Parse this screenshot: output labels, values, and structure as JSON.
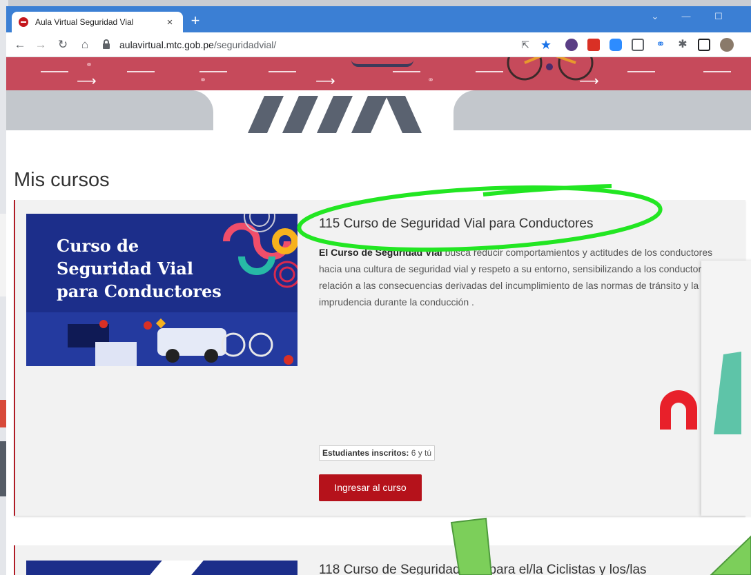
{
  "browser": {
    "tab_title": "Aula Virtual Seguridad Vial",
    "tab_close": "×",
    "new_tab": "+",
    "url_host": "aulavirtual.mtc.gob.pe",
    "url_path": "/seguridadvial/",
    "icons": [
      "share-icon",
      "star-icon",
      "extension-icon",
      "pdf-icon",
      "zoom-icon",
      "screenshot-icon",
      "link-icon",
      "puzzle-icon",
      "sidebar-icon",
      "profile-avatar"
    ],
    "colors": {
      "frame": "#3b7fd4",
      "star": "#1a73e8"
    }
  },
  "page": {
    "section_title": "Mis cursos",
    "courses": [
      {
        "title": "115 Curso de Seguridad Vial para Conductores",
        "thumbnail_lines": [
          "Curso de",
          "Seguridad Vial",
          "para Conductores"
        ],
        "desc_bold": "El Curso de Seguridad Vial",
        "desc_text": " busca reducir comportamientos y actitudes de los conductores hacia una cultura de seguridad vial y respeto a su entorno, sensibilizando a los conductores con relación a las consecuencias derivadas del incumplimiento de las normas de tránsito y la imprudencia durante la conducción .",
        "enrolled_label": "Estudiantes inscritos:",
        "enrolled_value": " 6 y tú",
        "button": "Ingresar al curso"
      },
      {
        "title": "118 Curso de Seguridad Vial para el/la Ciclistas y los/las"
      }
    ],
    "colors": {
      "brand_red": "#b5121b",
      "banner_lane": "#c64a5b",
      "thumb_blue": "#1c2e8a"
    }
  },
  "annotation": {
    "shapes": [
      "green-ellipse-highlight",
      "green-arrow"
    ],
    "color": "#22e622"
  }
}
